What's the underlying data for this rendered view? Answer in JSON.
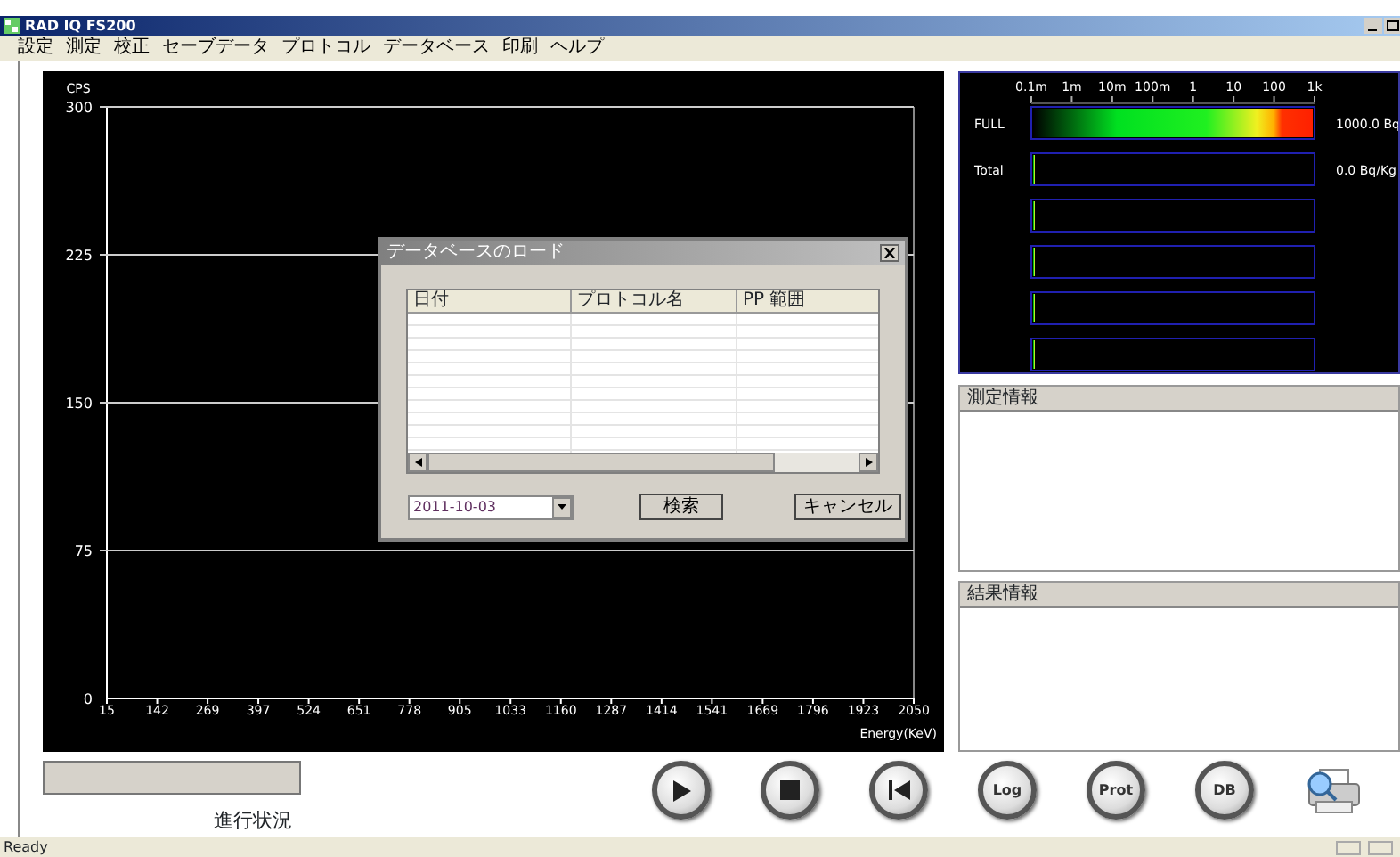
{
  "window": {
    "title": "RAD IQ FS200"
  },
  "menu": [
    "設定",
    "測定",
    "校正",
    "セーブデータ",
    "プロトコル",
    "データベース",
    "印刷",
    "ヘルプ"
  ],
  "chart": {
    "chart_data": {
      "type": "line",
      "xlabel": "Energy(KeV)",
      "ylabel": "CPS",
      "xlim": [
        15,
        2050
      ],
      "ylim": [
        0,
        300
      ],
      "xticks": [
        15,
        142,
        269,
        397,
        524,
        651,
        778,
        905,
        1033,
        1160,
        1287,
        1414,
        1541,
        1669,
        1796,
        1923,
        2050
      ],
      "yticks": [
        0,
        75,
        150,
        225,
        300
      ],
      "grid": true
    }
  },
  "dialog": {
    "title": "データベースのロード",
    "columns": [
      "日付",
      "プロトコル名",
      "PP 範囲"
    ],
    "date": "2011-10-03",
    "buttons": [
      "検索",
      "キャンセル"
    ]
  },
  "meter": {
    "scale_labels": [
      "0.1m",
      "1m",
      "10m",
      "100m",
      "1",
      "10",
      "100",
      "1k"
    ],
    "rows": [
      {
        "label": "FULL",
        "value": "1000.0 Bq",
        "level": 1
      },
      {
        "label": "Total",
        "value": "0.0 Bq/Kg",
        "level": 0
      },
      {
        "level": 0
      },
      {
        "level": 0
      },
      {
        "level": 0
      },
      {
        "level": 0
      }
    ]
  },
  "panels": [
    {
      "title": "測定情報"
    },
    {
      "title": "結果情報"
    }
  ],
  "progress": {
    "label": "進行状況",
    "level": 0
  },
  "controls": [
    {
      "kind": "play"
    },
    {
      "kind": "stop"
    },
    {
      "kind": "rewind"
    },
    {
      "kind": "text",
      "label": "Log"
    },
    {
      "kind": "text",
      "label": "Prot"
    },
    {
      "kind": "text",
      "label": "DB"
    },
    {
      "kind": "print"
    }
  ],
  "status_bar": {
    "text": "Ready"
  }
}
